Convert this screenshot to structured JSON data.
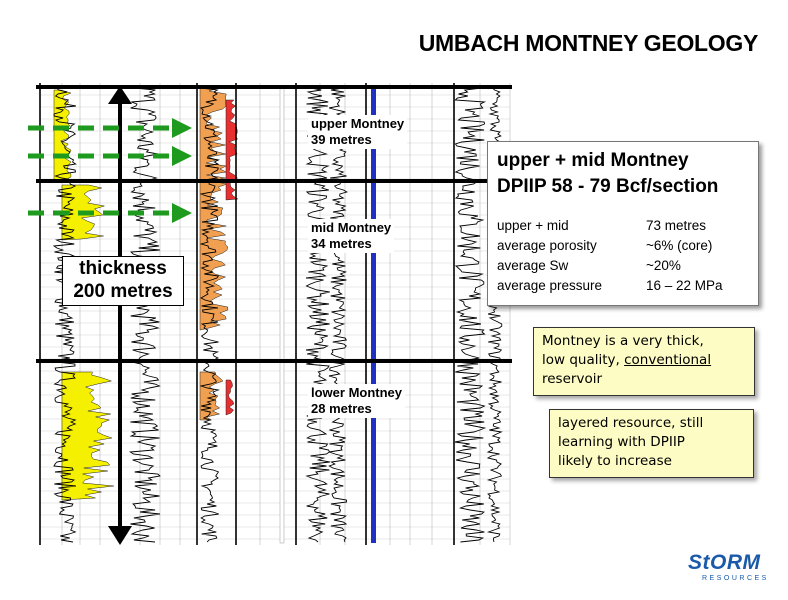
{
  "title": "UMBACH MONTNEY GEOLOGY",
  "zones": {
    "upper": {
      "name": "upper Montney",
      "thickness": "39 metres"
    },
    "mid": {
      "name": "mid Montney",
      "thickness": "34 metres"
    },
    "lower": {
      "name": "lower Montney",
      "thickness": "28 metres"
    }
  },
  "total_thickness": {
    "line1": "thickness",
    "line2": "200 metres"
  },
  "summary": {
    "heading1": "upper + mid Montney",
    "heading2": "DPIIP 58 - 79 Bcf/section",
    "rows": [
      {
        "label": "upper + mid",
        "value": "73 metres"
      },
      {
        "label": "average porosity",
        "value": "~6% (core)"
      },
      {
        "label": "average Sw",
        "value": "~20%"
      },
      {
        "label": "average pressure",
        "value": "16 – 22 MPa"
      }
    ]
  },
  "note1": {
    "line1": "Montney is a very thick,",
    "line2_pre": "low quality, ",
    "line2_u": "conventional",
    "line3": "reservoir"
  },
  "note2": {
    "line1": "layered resource, still",
    "line2": "learning with DPIIP",
    "line3": "likely to increase"
  },
  "logo": {
    "main": "StORM",
    "sub": "RESOURCES"
  },
  "colors": {
    "arrow_green": "#1e9a1e",
    "sand_yellow": "#f5f000",
    "fill_orange": "#f0a050",
    "fill_red": "#e83030",
    "track_blue": "#2030c0",
    "note_bg": "#fdfcc4",
    "logo_blue": "#1a5aa8"
  }
}
